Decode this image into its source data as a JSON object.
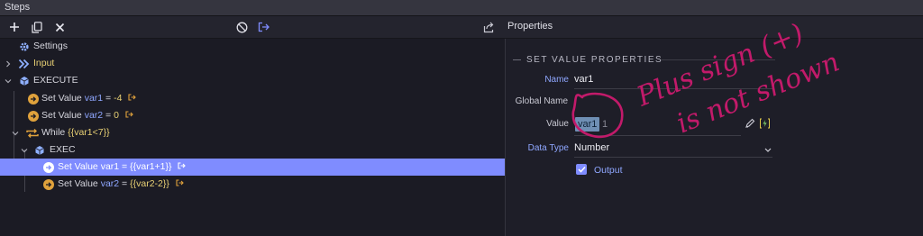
{
  "window": {
    "title": "Steps"
  },
  "toolbar": {
    "properties_label": "Properties"
  },
  "tree": {
    "settings": "Settings",
    "input": "Input",
    "execute": "EXECUTE",
    "step1": {
      "prefix": "Set Value",
      "var": "var1",
      "eq": " = ",
      "val": "-4"
    },
    "step2": {
      "prefix": "Set Value",
      "var": "var2",
      "eq": " = ",
      "val": "0"
    },
    "while": {
      "prefix": "While",
      "cond": "{{var1<7}}"
    },
    "exec": "EXEC",
    "step3": {
      "prefix": "Set Value",
      "var": "var1",
      "eq": " = ",
      "val": "{{var1+1}}"
    },
    "step4": {
      "prefix": "Set Value",
      "var": "var2",
      "eq": " = ",
      "val": "{{var2-2}}"
    }
  },
  "properties": {
    "section_title": "SET VALUE PROPERTIES",
    "name_label": "Name",
    "name_value": "var1",
    "global_name_label": "Global Name",
    "global_name_value": "",
    "value_label": "Value",
    "value_chip": "var1",
    "value_suffix": "1",
    "data_type_label": "Data Type",
    "data_type_value": "Number",
    "output_label": "Output",
    "output_checked": true
  },
  "annotation": {
    "line1": "Plus sign (+)",
    "line2": "is not shown",
    "color": "#c21a6a"
  },
  "colors": {
    "selection": "#7f8cff",
    "accent_orange": "#e0a23c",
    "var_blue": "#8fa7ff",
    "value_yellow": "#e8d074"
  }
}
